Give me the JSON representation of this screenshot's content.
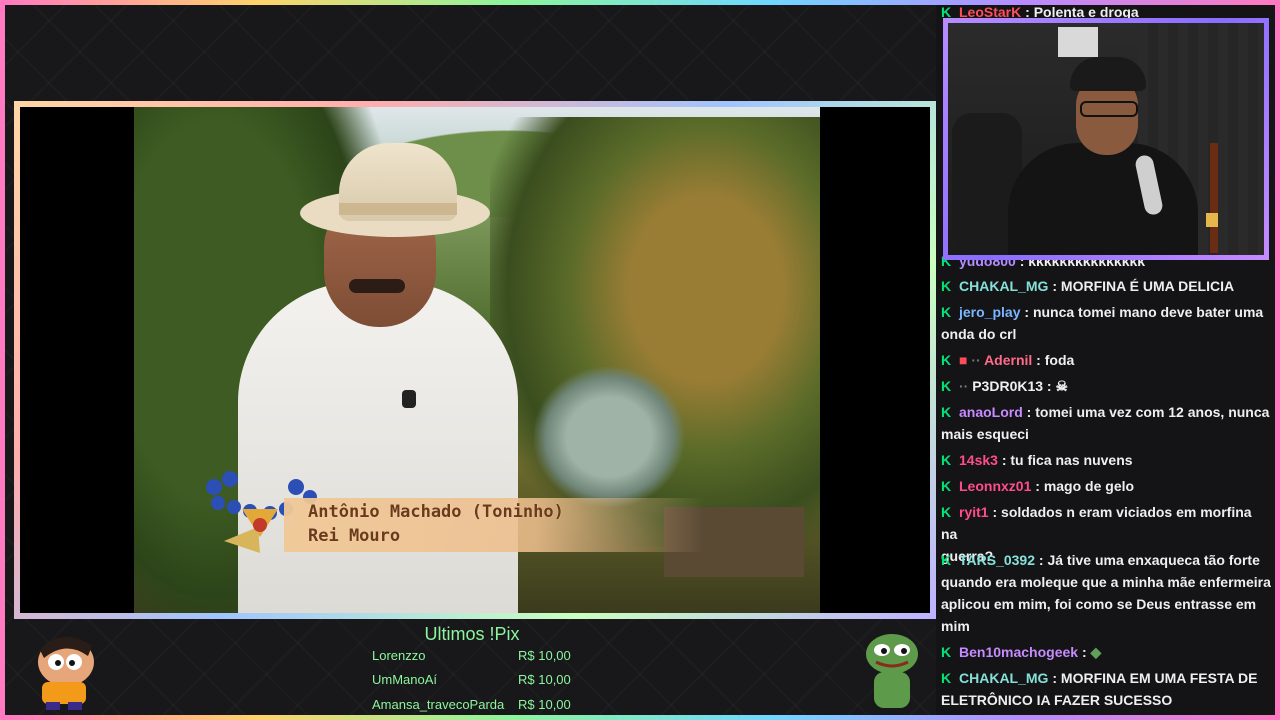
{
  "video": {
    "lower_third_name": "Antônio Machado (Toninho)",
    "lower_third_role": "Rei Mouro"
  },
  "pix": {
    "title": "Ultimos !Pix",
    "rows": [
      {
        "name": "Lorenzzo",
        "value": "R$ 10,00"
      },
      {
        "name": "UmManoAí",
        "value": "R$ 10,00"
      },
      {
        "name": "Amansa_travecoParda",
        "value": "R$ 10,00"
      }
    ]
  },
  "chat": {
    "lines": [
      {
        "user": "LeoStarK",
        "user_color": "#ff4d5a",
        "msg": "Polenta e droga"
      },
      {
        "user": "yudo800",
        "user_color": "#b68cff",
        "msg": "kkkkkkkkkkkkkkk"
      },
      {
        "user": "CHAKAL_MG",
        "user_color": "#86e0d8",
        "msg": "MORFINA É UMA DELICIA"
      },
      {
        "user": "jero_play",
        "user_color": "#7ab6ff",
        "msg": "nunca tomei mano deve bater uma",
        "msg2": "onda do crl"
      },
      {
        "user": "Adernil",
        "user_color": "#ff6b8a",
        "msg": "foda"
      },
      {
        "user": "P3DR0K13",
        "user_color": "#efeff1",
        "msg": ""
      },
      {
        "user": "anaoLord",
        "user_color": "#c58bff",
        "msg": "tomei uma vez com 12 anos, nunca",
        "msg2": "mais esqueci"
      },
      {
        "user": "14sk3",
        "user_color": "#ff4d8a",
        "msg": "tu fica nas nuvens"
      },
      {
        "user": "Leonnxz01",
        "user_color": "#ff4d8a",
        "msg": "mago de gelo"
      },
      {
        "user": "ryit1",
        "user_color": "#ff4d8a",
        "msg": "soldados n eram viciados em morfina na",
        "msg2": "guerra?"
      },
      {
        "user": "TARS_0392",
        "user_color": "#86e0d8",
        "msg": "Já tive uma enxaqueca tão forte",
        "msg2": "quando era moleque que a minha mãe enfermeira",
        "msg3": "aplicou em mim, foi como se Deus entrasse em",
        "msg4": "mim"
      },
      {
        "user": "Ben10machogeek",
        "user_color": "#c58bff",
        "msg": ""
      },
      {
        "user": "CHAKAL_MG",
        "user_color": "#86e0d8",
        "msg": "MORFINA EM UMA FESTA DE",
        "msg2": "ELETRÔNICO IA FAZER SUCESSO"
      }
    ],
    "k_icon": "k-badge-icon"
  },
  "colors": {
    "pix_green": "#8cf59d",
    "badge_green": "#00e676"
  }
}
